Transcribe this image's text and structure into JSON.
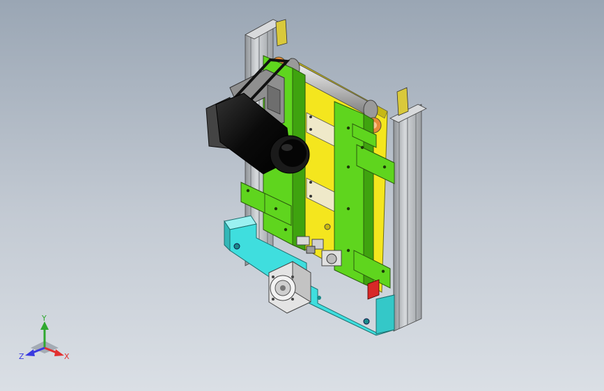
{
  "triad": {
    "x_label": "X",
    "y_label": "Y",
    "z_label": "Z",
    "x_color": "#e23030",
    "y_color": "#2fa82f",
    "z_color": "#3a3ae0"
  },
  "model_colors": {
    "green_plate": "#5fd51e",
    "yellow_belt": "#f4e61e",
    "cyan_base": "#3fdede",
    "aluminium": "#b8bcc0",
    "motor": "#111111",
    "orange_bearing": "#e88a3a",
    "red_stop": "#d82828"
  }
}
